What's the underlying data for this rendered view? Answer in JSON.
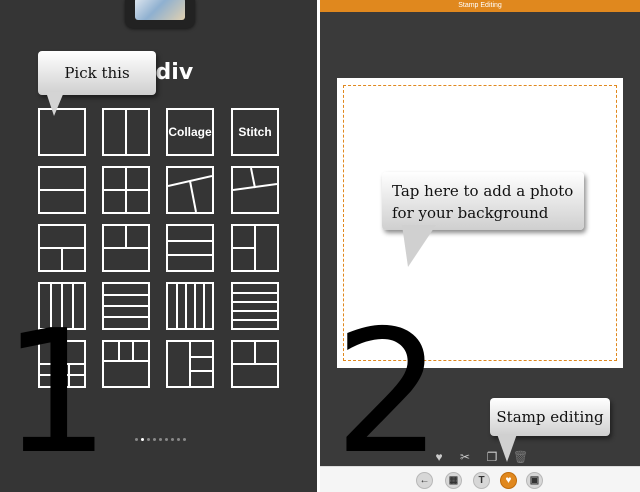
{
  "left_panel": {
    "app_title": "ldiv",
    "callout": "Pick this",
    "step_number": "1",
    "layouts": [
      {
        "id": "single"
      },
      {
        "id": "two-vertical"
      },
      {
        "id": "collage",
        "label": "Collage"
      },
      {
        "id": "stitch",
        "label": "Stitch"
      },
      {
        "id": "two-horizontal"
      },
      {
        "id": "four-grid"
      },
      {
        "id": "diagonal-three"
      },
      {
        "id": "angled-three"
      },
      {
        "id": "left-split"
      },
      {
        "id": "top-split"
      },
      {
        "id": "three-horizontal"
      },
      {
        "id": "right-split"
      },
      {
        "id": "four-columns"
      },
      {
        "id": "four-rows"
      },
      {
        "id": "five-columns"
      },
      {
        "id": "five-rows"
      },
      {
        "id": "bottom-three"
      },
      {
        "id": "top-three"
      },
      {
        "id": "right-stack"
      },
      {
        "id": "left-stack"
      }
    ],
    "pager": {
      "pages": 9,
      "current": 2
    }
  },
  "right_panel": {
    "window_title": "Stamp Editing",
    "canvas_callout": "Tap here to add a photo for your background",
    "step_number": "2",
    "stamp_callout": "Stamp editing",
    "tools": [
      {
        "icon": "heart-add-icon"
      },
      {
        "icon": "scissors-icon"
      },
      {
        "icon": "layers-icon"
      },
      {
        "icon": "trash-icon"
      }
    ],
    "bottom_bar": [
      {
        "icon": "back-arrow-icon",
        "glyph": "←"
      },
      {
        "icon": "grid-icon",
        "glyph": "▦"
      },
      {
        "icon": "text-icon",
        "glyph": "T"
      },
      {
        "icon": "heart-stamp-icon",
        "glyph": "♥",
        "active": true
      },
      {
        "icon": "save-icon",
        "glyph": "▣"
      }
    ],
    "accent_color": "#e0881e"
  }
}
